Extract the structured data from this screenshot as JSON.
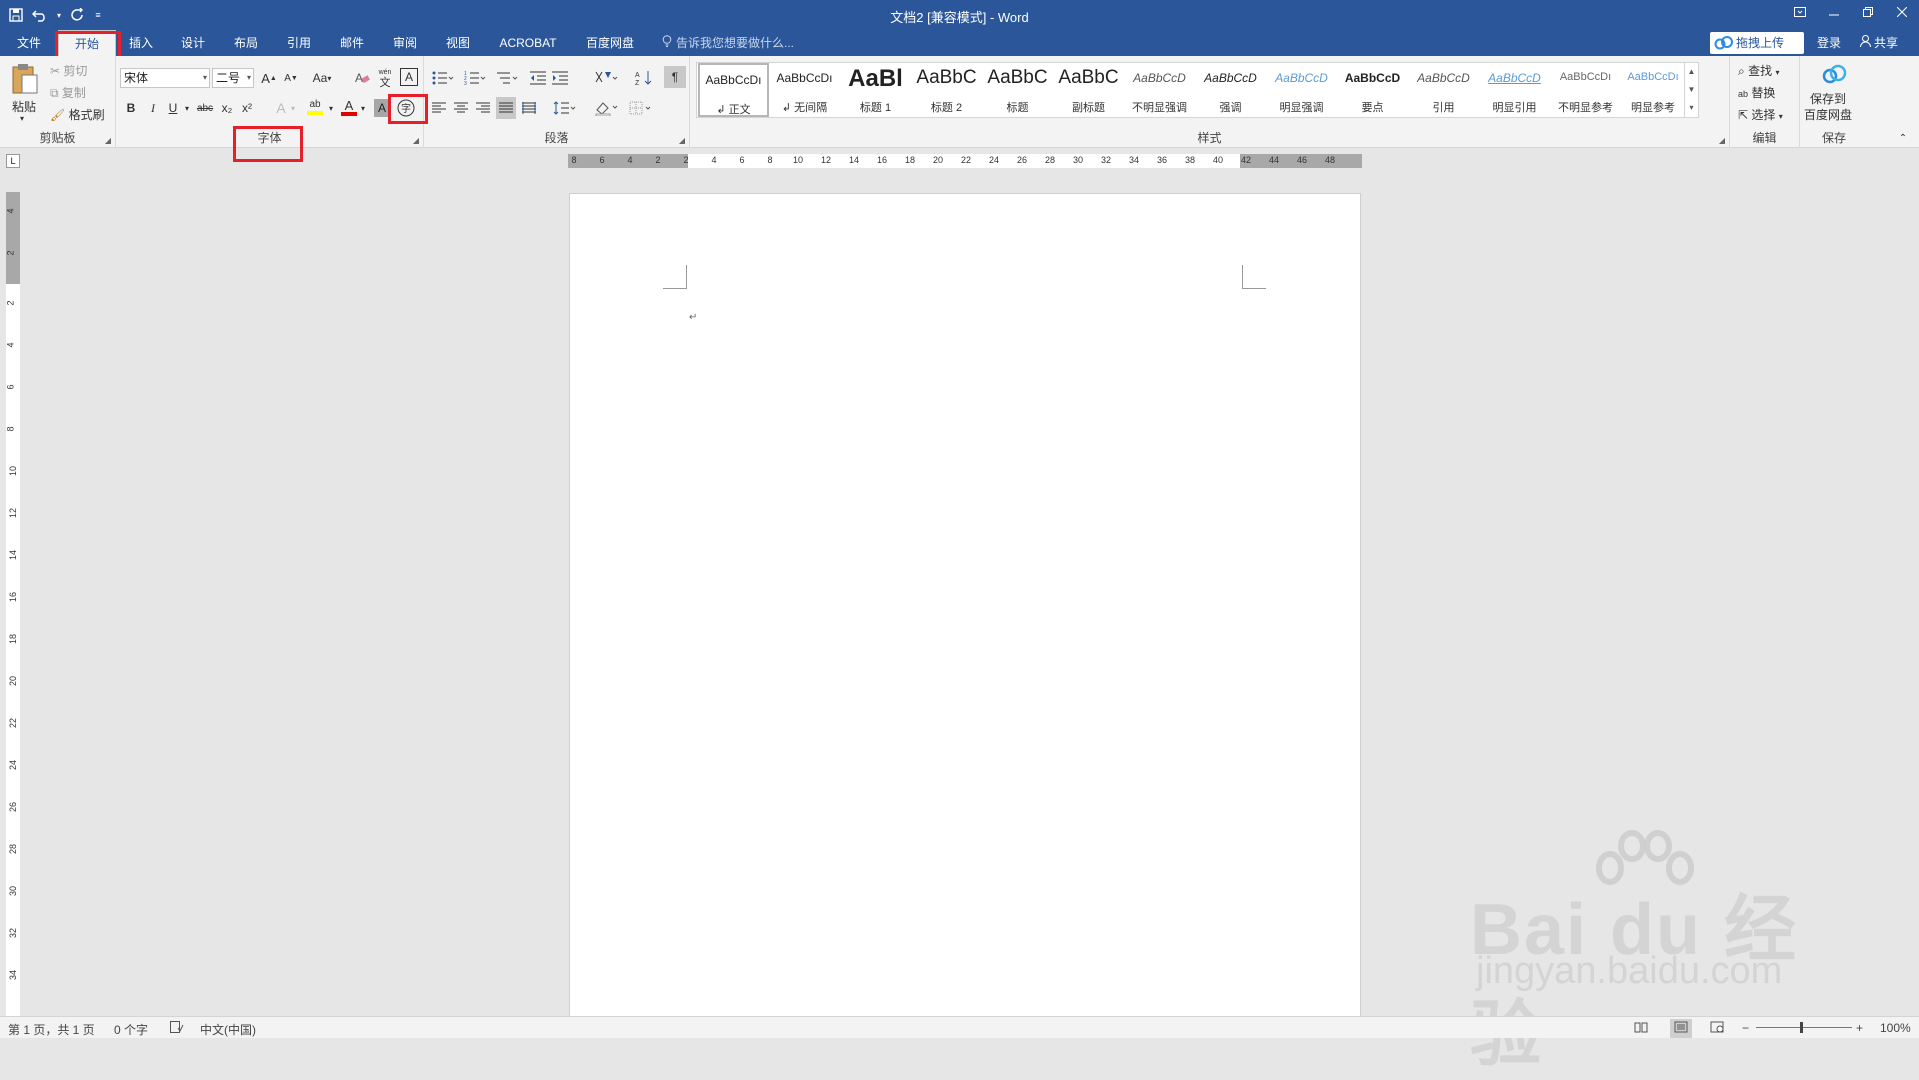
{
  "window": {
    "title": "文档2 [兼容模式] - Word",
    "controls": [
      "ribbon-display-icon",
      "minimize-icon",
      "restore-icon",
      "close-icon"
    ]
  },
  "qat": {
    "items": [
      "save-icon",
      "undo-icon",
      "redo-icon",
      "customize-icon"
    ]
  },
  "tabs": [
    {
      "label": "文件"
    },
    {
      "label": "开始",
      "active": true,
      "highlighted": true
    },
    {
      "label": "插入"
    },
    {
      "label": "设计"
    },
    {
      "label": "布局"
    },
    {
      "label": "引用"
    },
    {
      "label": "邮件"
    },
    {
      "label": "审阅"
    },
    {
      "label": "视图"
    },
    {
      "label": "ACROBAT"
    },
    {
      "label": "百度网盘"
    }
  ],
  "tell_me": "告诉我您想要做什么...",
  "upload_label": "拖拽上传",
  "login_label": "登录",
  "share_label": "共享",
  "clipboard": {
    "group": "剪贴板",
    "paste": "粘贴",
    "cut": "剪切",
    "copy": "复制",
    "format_painter": "格式刷"
  },
  "font": {
    "group": "字体",
    "group_highlighted": true,
    "font_name": "宋体",
    "font_size": "二号",
    "grow": "A",
    "shrink": "A",
    "case": "Aa",
    "phonetic_top": "wén",
    "phonetic_bottom": "文",
    "border_char": "A",
    "bold": "B",
    "italic": "I",
    "underline": "U",
    "strike": "abc",
    "sub": "x₂",
    "sup": "x²",
    "effects": "A",
    "highlight": "ab",
    "color": "A",
    "shading": "A",
    "enclose_char": "字",
    "enclose_highlighted": true
  },
  "paragraph": {
    "group": "段落"
  },
  "styles": {
    "group": "样式",
    "items": [
      {
        "preview": "AaBbCcDı",
        "label": "↲ 正文",
        "selected": true
      },
      {
        "preview": "AaBbCcDı",
        "label": "↲ 无间隔"
      },
      {
        "preview": "AaBl",
        "label": "标题 1"
      },
      {
        "preview": "AaBbC",
        "label": "标题 2"
      },
      {
        "preview": "AaBbC",
        "label": "标题"
      },
      {
        "preview": "AaBbC",
        "label": "副标题"
      },
      {
        "preview": "AaBbCcD",
        "label": "不明显强调"
      },
      {
        "preview": "AaBbCcD",
        "label": "强调"
      },
      {
        "preview": "AaBbCcD",
        "label": "明显强调"
      },
      {
        "preview": "AaBbCcD",
        "label": "要点"
      },
      {
        "preview": "AaBbCcD",
        "label": "引用"
      },
      {
        "preview": "AaBbCcD",
        "label": "明显引用"
      },
      {
        "preview": "AaBbCcDı",
        "label": "不明显参考"
      },
      {
        "preview": "AaBbCcDı",
        "label": "明显参考"
      }
    ]
  },
  "editing": {
    "group": "编辑",
    "find": "查找",
    "replace": "替换",
    "select": "选择"
  },
  "save_group": {
    "group": "保存",
    "line1": "保存到",
    "line2": "百度网盘"
  },
  "ruler": {
    "h_labels": [
      "8",
      "6",
      "4",
      "2",
      "2",
      "4",
      "6",
      "8",
      "10",
      "12",
      "14",
      "16",
      "18",
      "20",
      "22",
      "24",
      "26",
      "28",
      "30",
      "32",
      "34",
      "36",
      "38",
      "40",
      "42",
      "44",
      "46",
      "48"
    ],
    "v_labels": [
      "4",
      "2",
      "2",
      "4",
      "6",
      "8",
      "10",
      "12",
      "14",
      "16",
      "18",
      "20",
      "22",
      "24",
      "26",
      "28",
      "30",
      "32",
      "34"
    ]
  },
  "document": {
    "paragraph_mark": "↵"
  },
  "status": {
    "page": "第 1 页，共 1 页",
    "words": "0 个字",
    "language": "中文(中国)",
    "zoom": "100%"
  },
  "watermark": {
    "main": "Bai du 经验",
    "sub": "jingyan.baidu.com"
  }
}
